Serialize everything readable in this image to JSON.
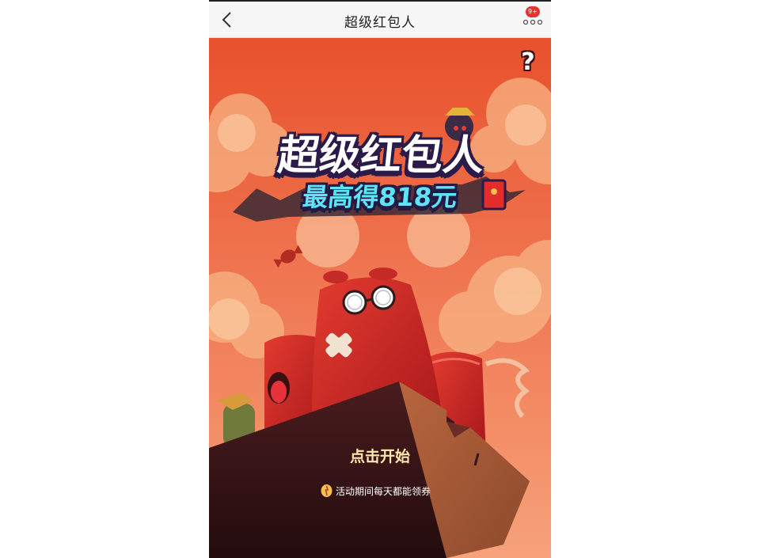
{
  "navbar": {
    "title": "超级红包人",
    "back_icon": "chevron-left-icon",
    "more_icon": "more-dots-icon",
    "badge": "9+"
  },
  "game": {
    "help_label": "?",
    "title": "超级红包人",
    "subtitle": "最高得818元",
    "start_label": "点击开始",
    "notice_icon": "coupon-icon",
    "notice_text": "活动期间每天都能领券"
  },
  "colors": {
    "sky_top": "#e8512c",
    "sky_bottom": "#f2936a",
    "title_text": "#ffffff",
    "subtitle_text": "#5fe3f7",
    "outline": "#2a1b4a",
    "character_red": "#c62424",
    "crate_dark": "#3a1518",
    "badge": "#e8322f"
  }
}
